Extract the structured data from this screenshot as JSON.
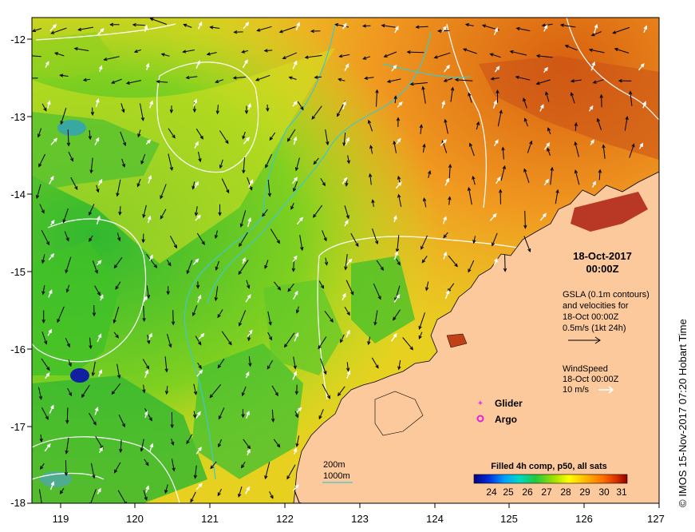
{
  "map": {
    "lon_ticks": [
      "119",
      "120",
      "121",
      "122",
      "123",
      "124",
      "125",
      "126",
      "127"
    ],
    "lat_ticks": [
      "-12",
      "-13",
      "-14",
      "-15",
      "-16",
      "-17",
      "-18"
    ],
    "lon_range": [
      118.65,
      127.0
    ],
    "lat_range": [
      -11.75,
      -18.0
    ]
  },
  "panel": {
    "date": "18-Oct-2017",
    "time": "00:00Z",
    "gsla_line1": "GSLA (0.1m contours)",
    "gsla_line2": "and velocities for",
    "gsla_line3": "18-Oct 00:00Z",
    "gsla_line4": "0.5m/s (1kt 24h)",
    "wind_line1": "WindSpeed",
    "wind_line2": "18-Oct 00:00Z",
    "wind_line3": "10 m/s"
  },
  "legend": {
    "glider": "Glider",
    "argo": "Argo",
    "glider_color": "#e040e0",
    "argo_color": "#e020e0"
  },
  "isobaths": {
    "label_200": "200m",
    "label_1000": "1000m",
    "color": "#40c8c8"
  },
  "colorbar": {
    "title": "Filled 4h comp, p50, all sats",
    "ticks": [
      "24",
      "25",
      "26",
      "27",
      "28",
      "29",
      "30",
      "31"
    ],
    "colors": [
      "#000090",
      "#0040ff",
      "#00c0ff",
      "#00e080",
      "#40d000",
      "#c0e000",
      "#ffff00",
      "#ffc000",
      "#ff8000",
      "#e04000",
      "#a00000"
    ]
  },
  "credit": "© IMOS 15-Nov-2017 07:20 Hobart Time",
  "colors": {
    "land": "#fcc99c",
    "ocean_warm": "#f0a020",
    "ocean_mid": "#e8e020",
    "ocean_cool": "#60c820"
  }
}
